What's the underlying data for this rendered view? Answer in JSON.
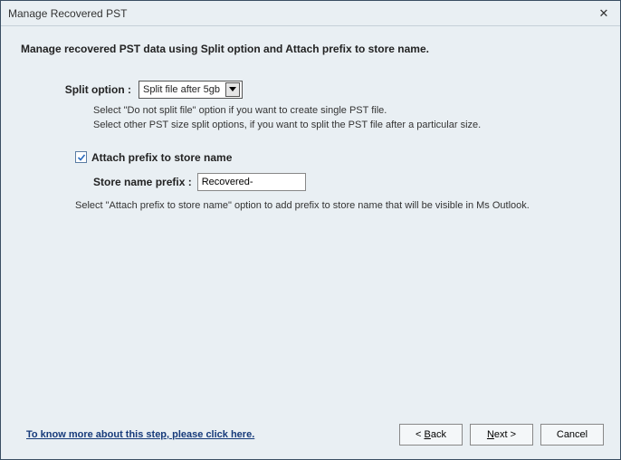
{
  "window": {
    "title": "Manage Recovered PST"
  },
  "heading": "Manage recovered PST data using Split option and Attach prefix to store name.",
  "split": {
    "label": "Split option :",
    "selected": "Split file after 5gb",
    "hint1": "Select \"Do not split file\" option if you want to create single PST file.",
    "hint2": "Select other PST size split options, if you want to split the PST file after a particular size."
  },
  "prefix": {
    "check_label": "Attach prefix to store name",
    "label": "Store name prefix :",
    "value": "Recovered-",
    "hint": "Select \"Attach prefix to store name\" option to add prefix to store name that will be visible in Ms Outlook."
  },
  "footer": {
    "help": "To know more about this step, please click here.",
    "back_pre": "< ",
    "back_mn": "B",
    "back_post": "ack",
    "next_mn": "N",
    "next_post": "ext >",
    "cancel": "Cancel"
  }
}
